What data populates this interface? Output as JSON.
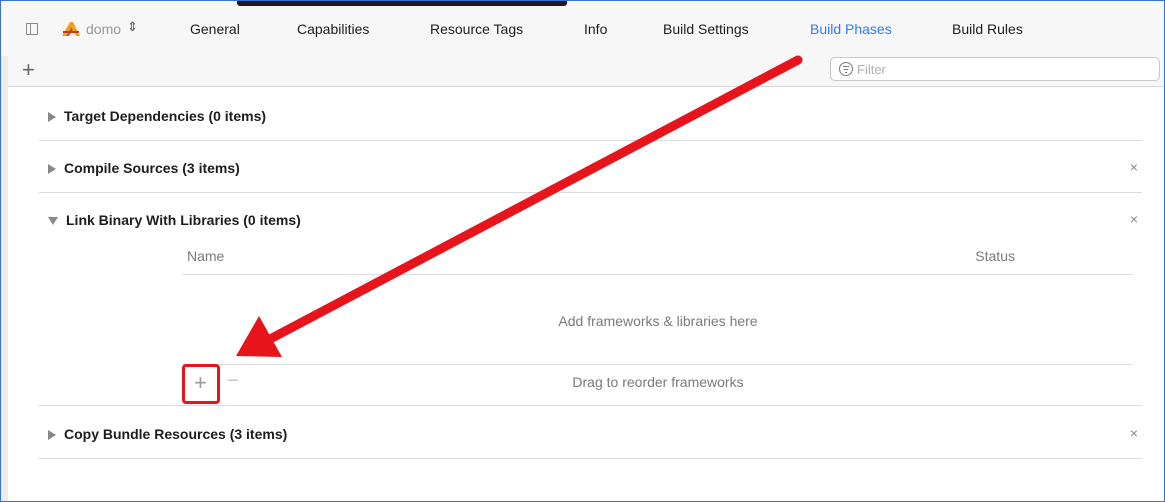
{
  "header": {
    "target_name": "domo",
    "target_chevron": "⌃⌄",
    "tabs": [
      {
        "label": "General",
        "active": false
      },
      {
        "label": "Capabilities",
        "active": false
      },
      {
        "label": "Resource Tags",
        "active": false
      },
      {
        "label": "Info",
        "active": false
      },
      {
        "label": "Build Settings",
        "active": false
      },
      {
        "label": "Build Phases",
        "active": true
      },
      {
        "label": "Build Rules",
        "active": false
      }
    ]
  },
  "toolbar": {
    "add_label": "+",
    "filter_placeholder": "Filter"
  },
  "phases": [
    {
      "title": "Target Dependencies (0 items)",
      "expanded": false,
      "removable": false
    },
    {
      "title": "Compile Sources (3 items)",
      "expanded": false,
      "removable": true
    },
    {
      "title": "Link Binary With Libraries (0 items)",
      "expanded": true,
      "removable": true
    },
    {
      "title": "Copy Bundle Resources (3 items)",
      "expanded": false,
      "removable": true
    }
  ],
  "remove_label": "×",
  "libraries": {
    "col_name": "Name",
    "col_status": "Status",
    "empty_message": "Add frameworks & libraries here",
    "add_label": "+",
    "remove_label": "−",
    "reorder_message": "Drag to reorder frameworks"
  },
  "colors": {
    "accent": "#2f7bf5",
    "highlight": "#e8141b"
  }
}
